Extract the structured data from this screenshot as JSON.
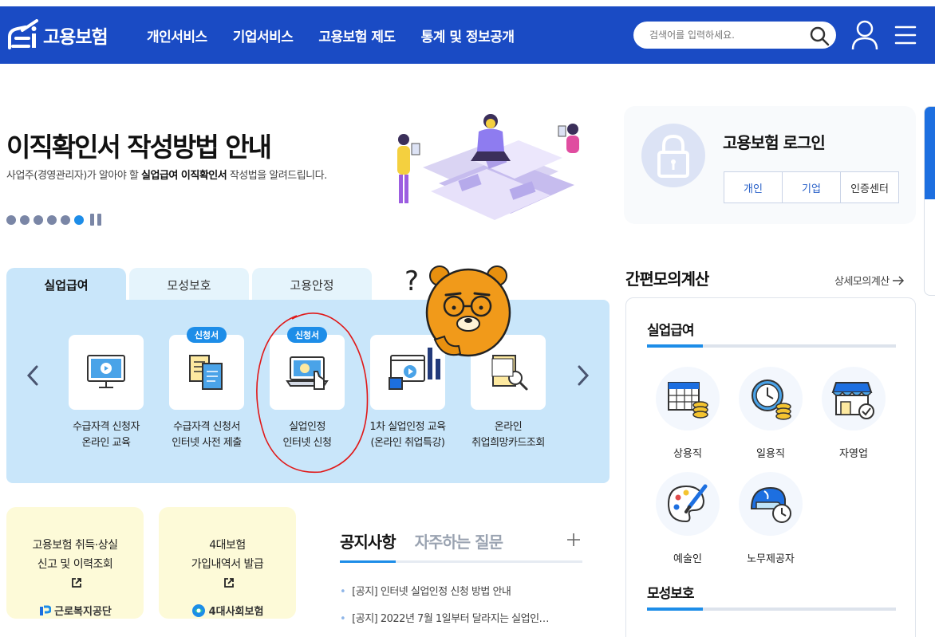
{
  "header": {
    "logo_text": "고용보험",
    "nav": [
      "개인서비스",
      "기업서비스",
      "고용보험 제도",
      "통계 및 정보공개"
    ],
    "search_placeholder": "검색어를 입력하세요."
  },
  "banner": {
    "title": "이직확인서 작성방법 안내",
    "subtitle_pre": "사업주(경영관리자)가 알아야 할 ",
    "subtitle_bold": "실업급여 이직확인서",
    "subtitle_post": " 작성법을 알려드립니다.",
    "slide_count": 6,
    "active_slide": 6
  },
  "login": {
    "title": "고용보험 로그인",
    "buttons": [
      "개인",
      "기업",
      "인증센터"
    ]
  },
  "tabs": [
    "실업급여",
    "모성보호",
    "고용안정"
  ],
  "services": [
    {
      "line1": "수급자격 신청자",
      "line2": "온라인 교육",
      "badge": ""
    },
    {
      "line1": "수급자격 신청서",
      "line2": "인터넷 사전 제출",
      "badge": "신청서"
    },
    {
      "line1": "실업인정",
      "line2": "인터넷 신청",
      "badge": "신청서"
    },
    {
      "line1": "1차 실업인정 교육",
      "line2": "(온라인 취업특강)",
      "badge": ""
    },
    {
      "line1": "온라인",
      "line2": "취업희망카드조회",
      "badge": ""
    }
  ],
  "ext_cards": [
    {
      "line1": "고용보험 취득·상실",
      "line2": "신고 및 이력조회",
      "org": "근로복지공단"
    },
    {
      "line1": "4대보험",
      "line2": "가입내역서 발급",
      "org": "4대사회보험"
    }
  ],
  "notice": {
    "tabs": [
      "공지사항",
      "자주하는 질문"
    ],
    "items": [
      "[공지] 인터넷 실업인정 신청 방법 안내",
      "[공지] 2022년 7월 1일부터 달라지는 실업인…"
    ]
  },
  "calc": {
    "title": "간편모의계산",
    "more": "상세모의계산",
    "section1": "실업급여",
    "items": [
      "상용직",
      "일용직",
      "자영업",
      "예술인",
      "노무제공자"
    ],
    "section2": "모성보호"
  },
  "colors": {
    "brand": "#1a4bc4",
    "accent": "#1d8de8",
    "panel": "#c9e6fa"
  }
}
